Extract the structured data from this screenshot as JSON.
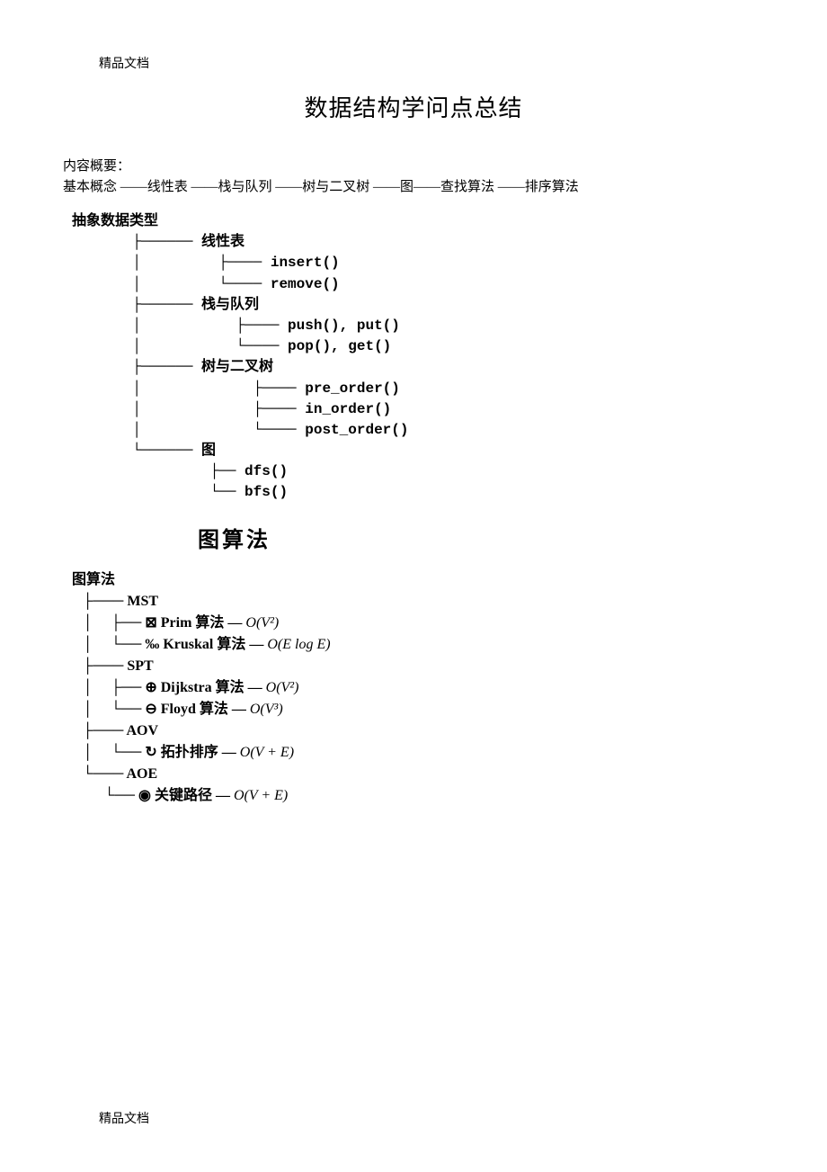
{
  "header_small": "精品文档",
  "title": "数据结构学问点总结",
  "intro_label": "内容概要：",
  "intro_line": "基本概念  ——线性表  ——栈与队列  ——树与二叉树  ——图——查找算法  ——排序算法",
  "tree1": {
    "root": "抽象数据类型",
    "n1": "线性表",
    "n1a": "insert()",
    "n1b": "remove()",
    "n2": "栈与队列",
    "n2a": "push(), put()",
    "n2b": "pop(), get()",
    "n3": "树与二叉树",
    "n3a": "pre_order()",
    "n3b": "in_order()",
    "n3c": "post_order()",
    "n4": "图",
    "n4a": "dfs()",
    "n4b": "bfs()"
  },
  "section2_heading": "图算法",
  "tree2": {
    "root": "图算法",
    "mst": "MST",
    "mst_a_algo": "Prim 算法",
    "mst_a_o": "O(V²)",
    "mst_b_algo": "Kruskal 算法",
    "mst_b_o": "O(E log E)",
    "spt": "SPT",
    "spt_a_algo": "Dijkstra 算法",
    "spt_a_o": "O(V²)",
    "spt_b_algo": "Floyd 算法",
    "spt_b_o": "O(V³)",
    "aov": "AOV",
    "aov_a_algo": "拓扑排序",
    "aov_a_o": "O(V + E)",
    "aoe": "AOE",
    "aoe_a_algo": "关键路径",
    "aoe_a_o": "O(V + E)"
  },
  "footer_small": "精品文档"
}
